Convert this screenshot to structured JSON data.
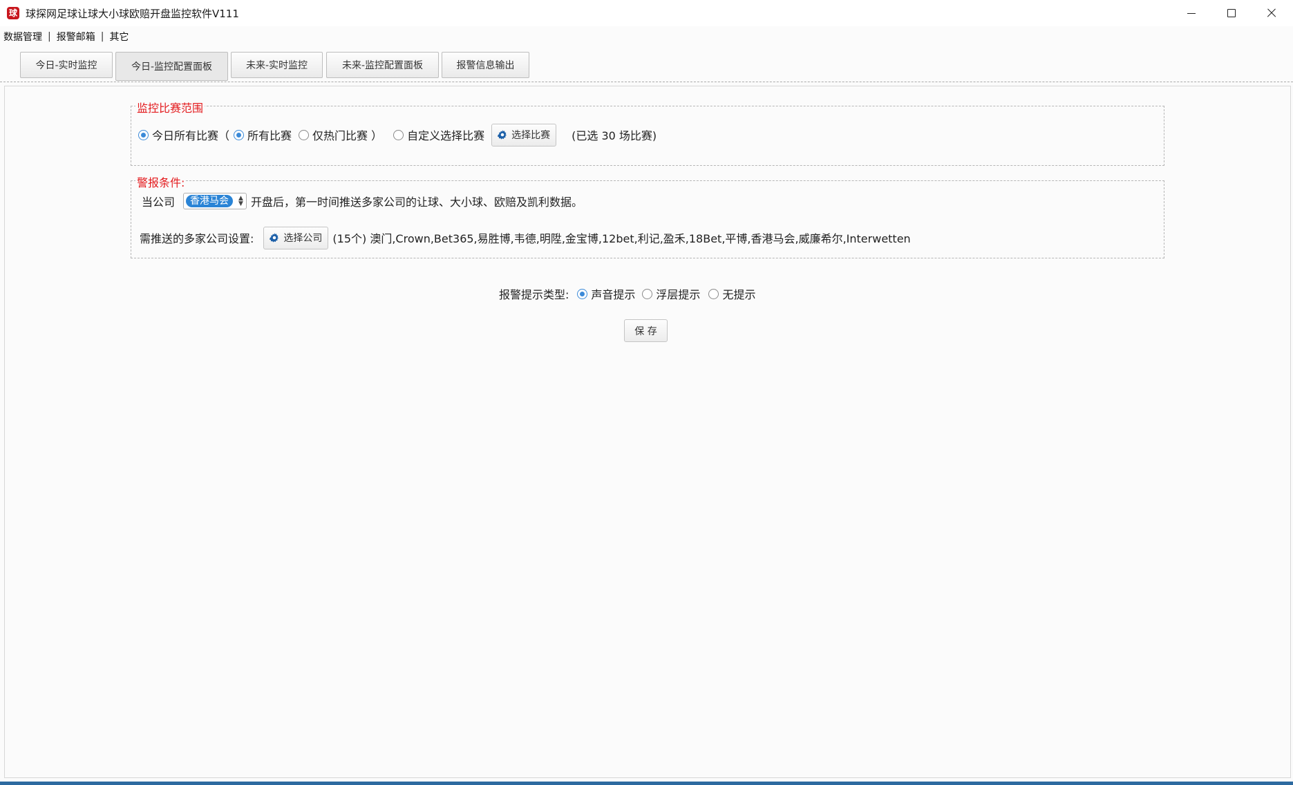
{
  "window": {
    "title": "球探网足球让球大小球欧赔开盘监控软件V111",
    "app_icon": "球"
  },
  "menu": [
    {
      "label": "数据管理"
    },
    {
      "label": "报警邮箱"
    },
    {
      "label": "其它"
    }
  ],
  "menu_separator": "|",
  "tabs": [
    {
      "label": "今日-实时监控",
      "active": false
    },
    {
      "label": "今日-监控配置面板",
      "active": true
    },
    {
      "label": "未来-实时监控",
      "active": false
    },
    {
      "label": "未来-监控配置面板",
      "active": false
    },
    {
      "label": "报警信息输出",
      "active": false
    }
  ],
  "scope": {
    "legend": "监控比赛范围",
    "today_all_label": "今日所有比赛（",
    "all_matches_label": "所有比赛",
    "hot_only_label": "仅热门比赛 ）",
    "custom_label": "自定义选择比赛",
    "select_matches_button": "选择比赛",
    "selected_text": "(已选  30  场比赛)",
    "today_all_checked": true,
    "all_matches_checked": true,
    "hot_only_checked": false,
    "custom_checked": false
  },
  "alarm": {
    "legend": "警报条件:",
    "company_prefix": "当公司",
    "company_value": "香港马会",
    "company_suffix": "开盘后，第一时间推送多家公司的让球、大小球、欧赔及凯利数据。",
    "push_label": "需推送的多家公司设置:",
    "select_company_button": "选择公司",
    "companies_text": "(15个) 澳门,Crown,Bet365,易胜博,韦德,明陞,金宝博,12bet,利记,盈禾,18Bet,平博,香港马会,威廉希尔,Interwetten"
  },
  "notify": {
    "label": "报警提示类型:",
    "options": [
      {
        "label": "声音提示",
        "checked": true
      },
      {
        "label": "浮层提示",
        "checked": false
      },
      {
        "label": "无提示",
        "checked": false
      }
    ]
  },
  "save_button": "保 存",
  "colors": {
    "legend_red": "#e3191c",
    "radio_blue": "#3b8ad8",
    "select_blue": "#2a84d6",
    "gear_blue": "#1b5fa8",
    "bottom_bar": "#2d6aa0"
  },
  "icons": {
    "gear": "gear-icon",
    "app": "app-logo-icon"
  }
}
